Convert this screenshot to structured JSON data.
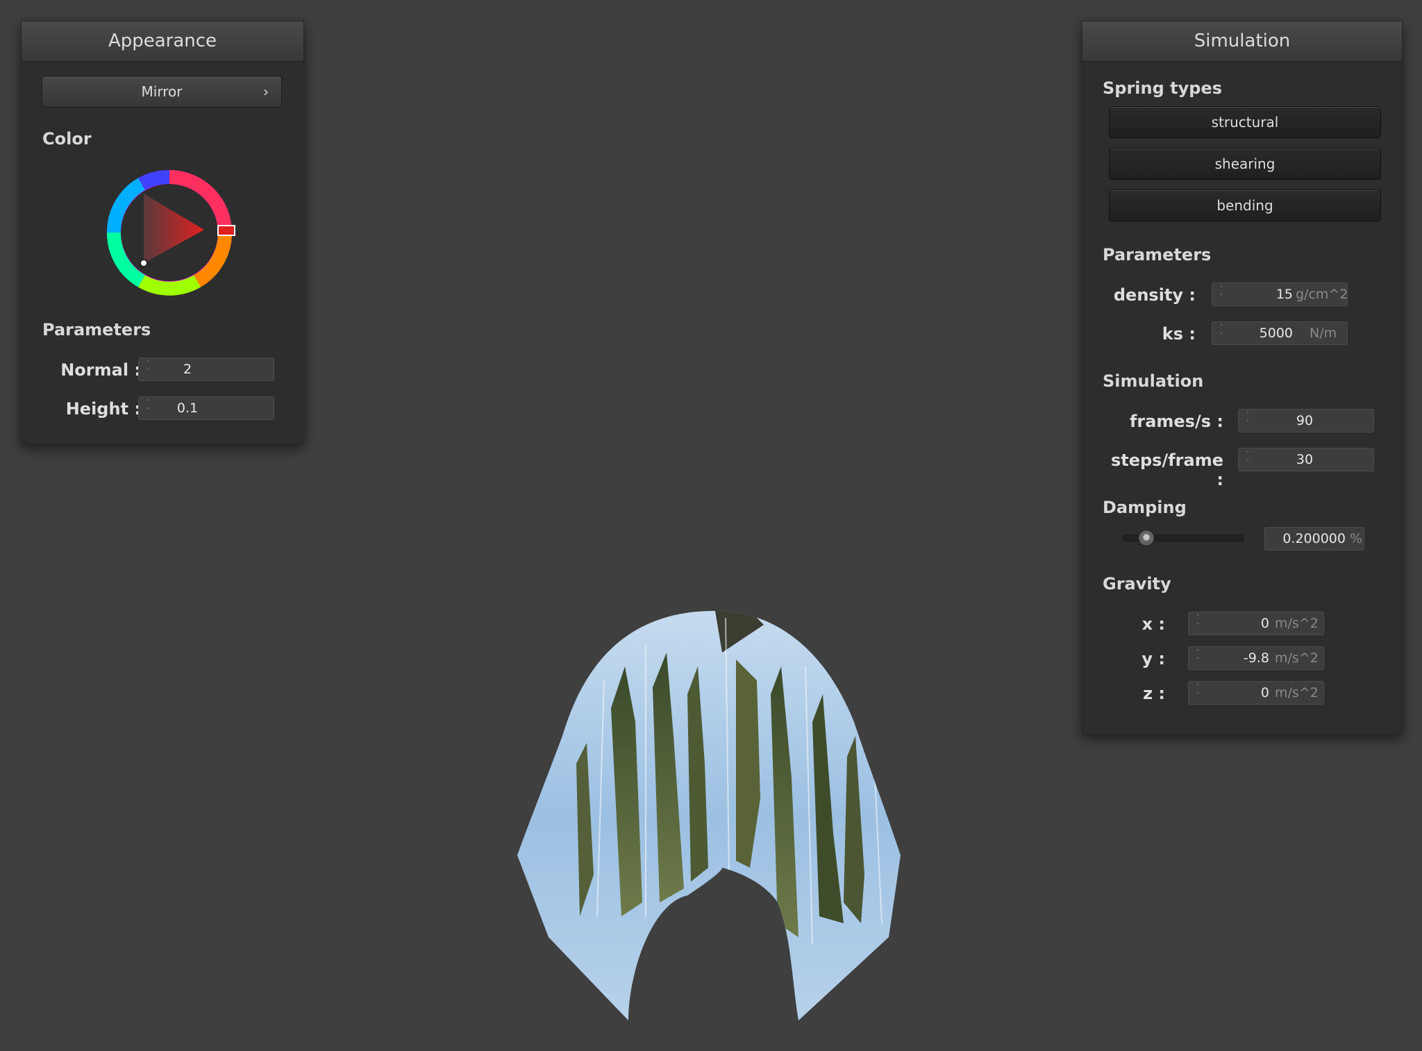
{
  "appearance": {
    "title": "Appearance",
    "shader_selected": "Mirror",
    "color_label": "Color",
    "color_value": "#e02020",
    "params_label": "Parameters",
    "normal": {
      "label": "Normal :",
      "value": "2"
    },
    "height": {
      "label": "Height :",
      "value": "0.1"
    }
  },
  "simulation": {
    "title": "Simulation",
    "spring_types_label": "Spring types",
    "spring_buttons": [
      "structural",
      "shearing",
      "bending"
    ],
    "params_label": "Parameters",
    "density": {
      "label": "density :",
      "value": "15",
      "unit": "g/cm^2"
    },
    "ks": {
      "label": "ks :",
      "value": "5000",
      "unit": "N/m"
    },
    "sim_label": "Simulation",
    "fps": {
      "label": "frames/s :",
      "value": "90"
    },
    "steps": {
      "label": "steps/frame :",
      "value": "30"
    },
    "damping_label": "Damping",
    "damping": {
      "value": "0.200000",
      "unit": "%",
      "slider_fraction": 0.2
    },
    "gravity_label": "Gravity",
    "gx": {
      "label": "x :",
      "value": "0",
      "unit": "m/s^2"
    },
    "gy": {
      "label": "y :",
      "value": "-9.8",
      "unit": "m/s^2"
    },
    "gz": {
      "label": "z :",
      "value": "0",
      "unit": "m/s^2"
    }
  },
  "icons": {
    "combo_arrow": "chevron-right-icon",
    "spinner": "spinner-arrows-icon"
  }
}
